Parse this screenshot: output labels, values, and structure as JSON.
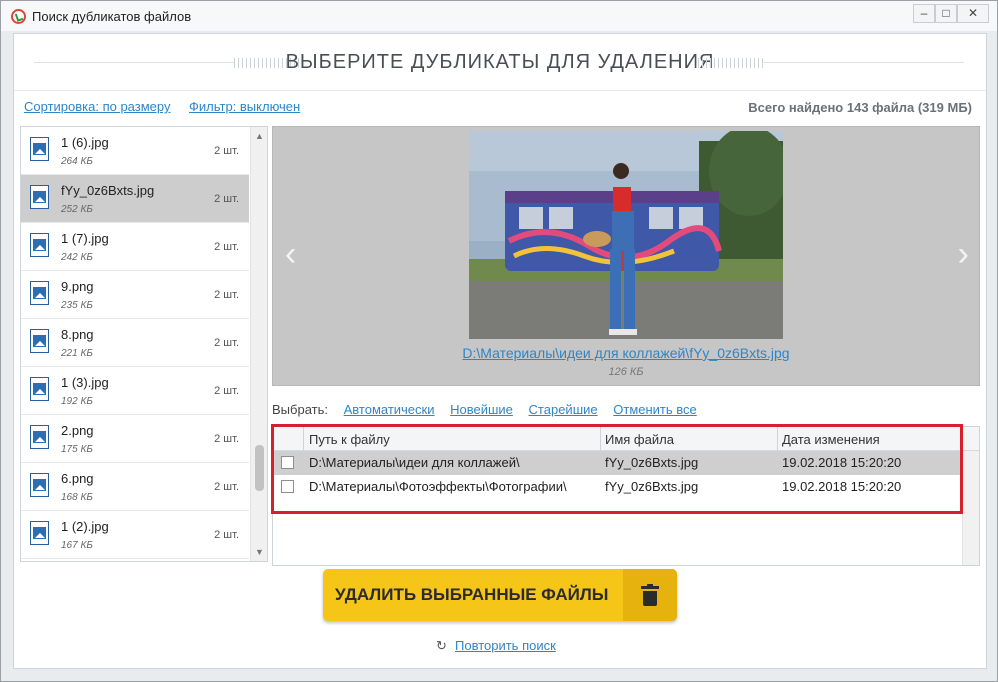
{
  "window": {
    "title": "Поиск дубликатов файлов",
    "minimize_label": "–",
    "maximize_label": "□",
    "close_label": "✕"
  },
  "header": {
    "title": "ВЫБЕРИТЕ ДУБЛИКАТЫ ДЛЯ УДАЛЕНИЯ"
  },
  "toolbar": {
    "sort_link": "Сортировка: по размеру",
    "filter_link": "Фильтр: выключен",
    "total_found": "Всего найдено 143 файла (319 МБ)"
  },
  "file_list": [
    {
      "name": "1 (6).jpg",
      "size": "264 КБ",
      "count": "2 шт.",
      "selected": false
    },
    {
      "name": "fYy_0z6Bxts.jpg",
      "size": "252 КБ",
      "count": "2 шт.",
      "selected": true
    },
    {
      "name": "1 (7).jpg",
      "size": "242 КБ",
      "count": "2 шт.",
      "selected": false
    },
    {
      "name": "9.png",
      "size": "235 КБ",
      "count": "2 шт.",
      "selected": false
    },
    {
      "name": "8.png",
      "size": "221 КБ",
      "count": "2 шт.",
      "selected": false
    },
    {
      "name": "1 (3).jpg",
      "size": "192 КБ",
      "count": "2 шт.",
      "selected": false
    },
    {
      "name": "2.png",
      "size": "175 КБ",
      "count": "2 шт.",
      "selected": false
    },
    {
      "name": "6.png",
      "size": "168 КБ",
      "count": "2 шт.",
      "selected": false
    },
    {
      "name": "1 (2).jpg",
      "size": "167 КБ",
      "count": "2 шт.",
      "selected": false
    }
  ],
  "list_scroll": {
    "up": "▲",
    "down": "▼"
  },
  "preview": {
    "path": "D:\\Материалы\\идеи для коллажей\\fYy_0z6Bxts.jpg",
    "size": "126 КБ",
    "prev_arrow": "‹",
    "next_arrow": "›"
  },
  "select_bar": {
    "label": "Выбрать:",
    "auto": "Автоматически",
    "newest": "Новейшие",
    "oldest": "Старейшие",
    "cancel_all": "Отменить все"
  },
  "table": {
    "columns": [
      "Путь к файлу",
      "Имя файла",
      "Дата изменения"
    ],
    "rows": [
      {
        "path": "D:\\Материалы\\идеи для коллажей\\",
        "name": "fYy_0z6Bxts.jpg",
        "date": "19.02.2018 15:20:20",
        "selected": true
      },
      {
        "path": "D:\\Материалы\\Фотоэффекты\\Фотографии\\",
        "name": "fYy_0z6Bxts.jpg",
        "date": "19.02.2018 15:20:20",
        "selected": false
      }
    ]
  },
  "actions": {
    "delete_button": "УДАЛИТЬ ВЫБРАННЫЕ ФАЙЛЫ",
    "repeat_icon": "↻",
    "repeat_search": "Повторить поиск"
  },
  "colors": {
    "accent_link": "#2d86c8",
    "delete_button": "#f5c518",
    "highlight_frame": "#d6202c"
  }
}
